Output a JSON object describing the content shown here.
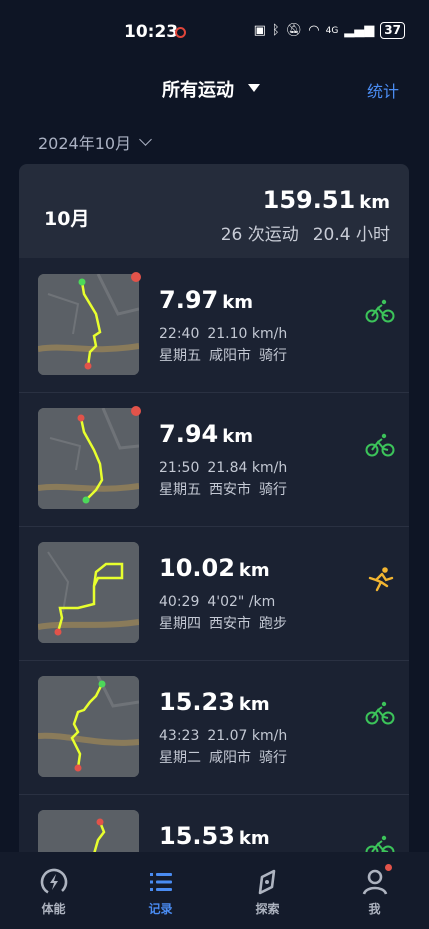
{
  "status": {
    "time": "10:23",
    "battery": "37",
    "network": "4G"
  },
  "header": {
    "title": "所有运动",
    "stats": "统计"
  },
  "month_select": "2024年10月",
  "summary": {
    "month": "10月",
    "distance": "159.51",
    "unit": "km",
    "count": "26 次运动",
    "hours": "20.4 小时"
  },
  "activities": [
    {
      "distance": "7.97",
      "unit": "km",
      "duration": "22:40",
      "pace": "21.10 km/h",
      "day": "星期五",
      "city": "咸阳市",
      "type": "骑行",
      "sport_icon": "cycling-icon"
    },
    {
      "distance": "7.94",
      "unit": "km",
      "duration": "21:50",
      "pace": "21.84 km/h",
      "day": "星期五",
      "city": "西安市",
      "type": "骑行",
      "sport_icon": "cycling-icon"
    },
    {
      "distance": "10.02",
      "unit": "km",
      "duration": "40:29",
      "pace": "4'02\" /km",
      "day": "星期四",
      "city": "西安市",
      "type": "跑步",
      "sport_icon": "running-icon"
    },
    {
      "distance": "15.23",
      "unit": "km",
      "duration": "43:23",
      "pace": "21.07 km/h",
      "day": "星期二",
      "city": "咸阳市",
      "type": "骑行",
      "sport_icon": "cycling-icon"
    },
    {
      "distance": "15.53",
      "unit": "km",
      "duration": "",
      "pace": "",
      "day": "",
      "city": "",
      "type": "",
      "sport_icon": "cycling-icon"
    }
  ],
  "tabs": [
    {
      "label": "体能",
      "icon": "fitness-icon"
    },
    {
      "label": "记录",
      "icon": "records-icon"
    },
    {
      "label": "探索",
      "icon": "explore-icon"
    },
    {
      "label": "我",
      "icon": "profile-icon"
    }
  ],
  "colors": {
    "accent": "#4a8cf2",
    "cycling": "#3cc45a",
    "running": "#f2b531",
    "route": "#e8ff2e"
  }
}
